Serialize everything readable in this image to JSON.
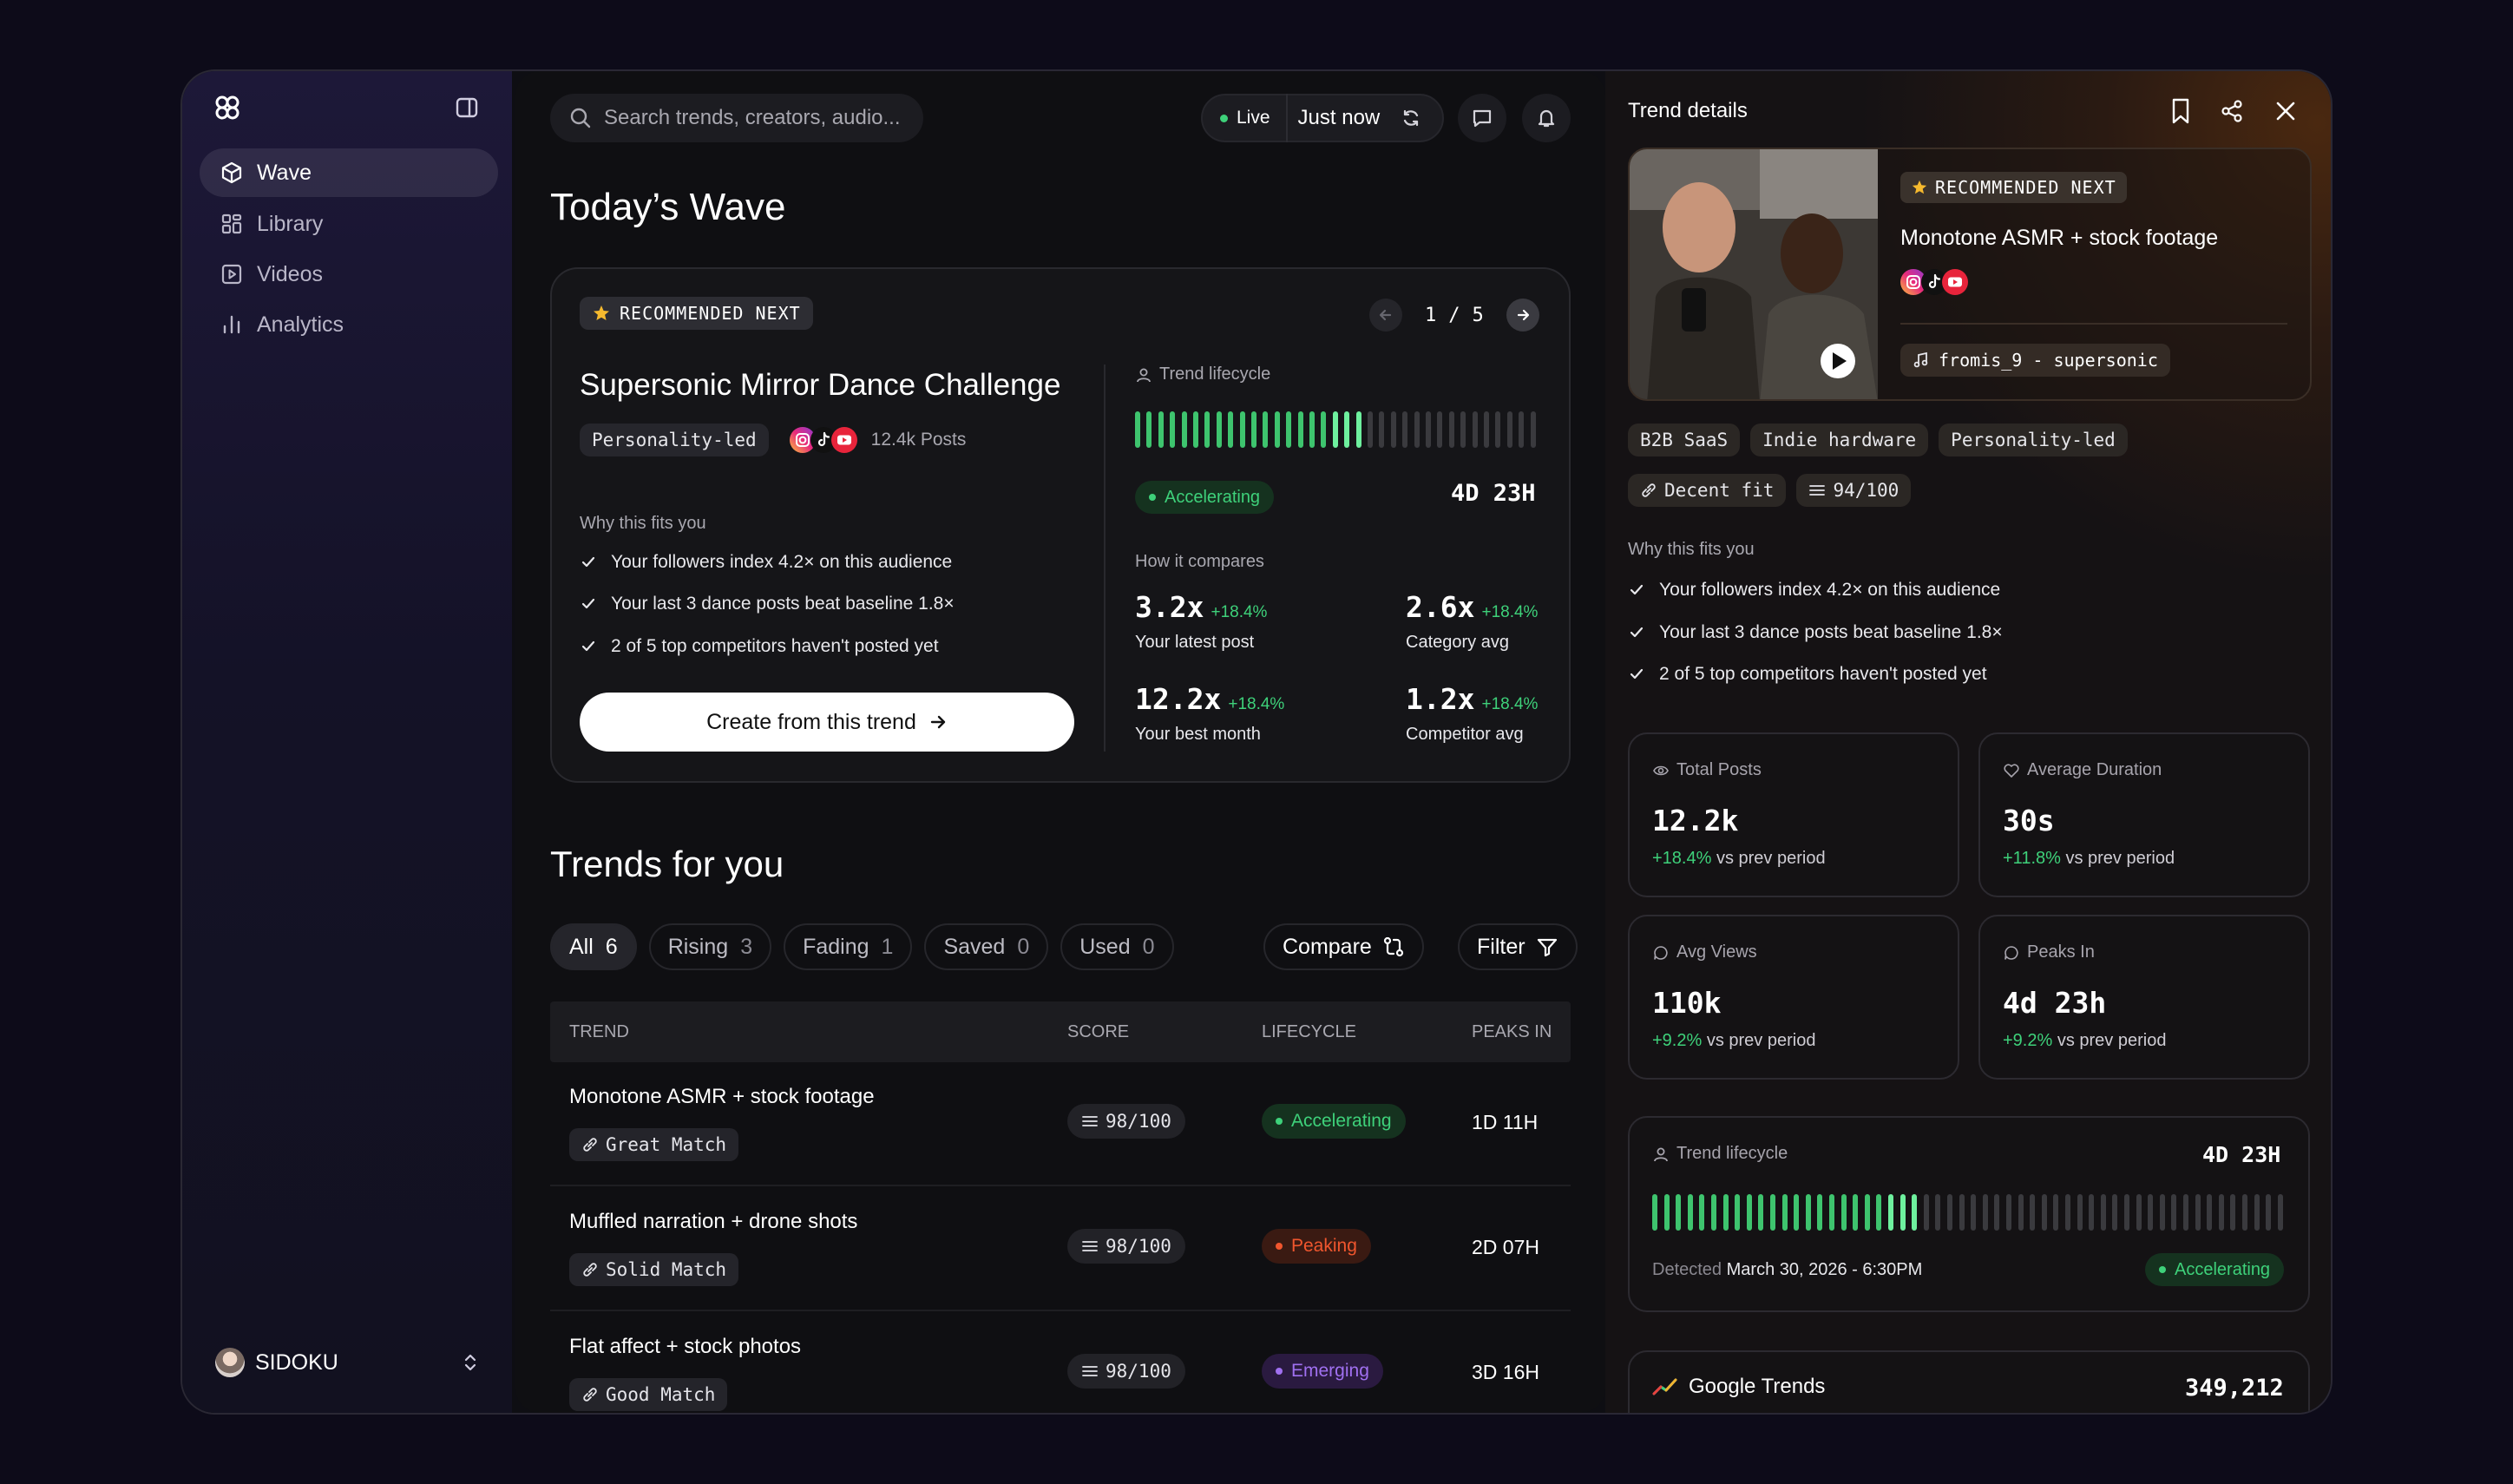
{
  "sidebar": {
    "nav": [
      {
        "label": "Wave",
        "icon": "cube-icon"
      },
      {
        "label": "Library",
        "icon": "grid-icon"
      },
      {
        "label": "Videos",
        "icon": "play-square-icon"
      },
      {
        "label": "Analytics",
        "icon": "bar-chart-icon"
      }
    ],
    "user": {
      "name": "SIDOKU"
    }
  },
  "topbar": {
    "search_placeholder": "Search trends, creators, audio...",
    "live_label": "Live",
    "updated_label": "Just now"
  },
  "wave": {
    "title": "Today’s Wave",
    "badge": "RECOMMENDED NEXT",
    "pager": {
      "current": "1",
      "sep": "/",
      "total": "5"
    },
    "trend_name": "Supersonic Mirror Dance Challenge",
    "tag": "Personality-led",
    "posts": "12.4k Posts",
    "why_title": "Why this fits you",
    "reasons": [
      "Your followers index 4.2× on this audience",
      "Your last 3 dance posts beat baseline 1.8×",
      "2 of 5 top competitors haven't posted yet"
    ],
    "cta": "Create from this trend",
    "lifecycle_label": "Trend lifecycle",
    "lifecycle_progress": 0.57,
    "status": "Accelerating",
    "time_left": "4D 23H",
    "compare_title": "How it compares",
    "compares": [
      {
        "value": "3.2x",
        "delta": "+18.4%",
        "label": "Your latest post"
      },
      {
        "value": "2.6x",
        "delta": "+18.4%",
        "label": "Category avg"
      },
      {
        "value": "12.2x",
        "delta": "+18.4%",
        "label": "Your best month"
      },
      {
        "value": "1.2x",
        "delta": "+18.4%",
        "label": "Competitor avg"
      }
    ]
  },
  "trends": {
    "title": "Trends for you",
    "tabs": [
      {
        "label": "All",
        "count": "6"
      },
      {
        "label": "Rising",
        "count": "3"
      },
      {
        "label": "Fading",
        "count": "1"
      },
      {
        "label": "Saved",
        "count": "0"
      },
      {
        "label": "Used",
        "count": "0"
      }
    ],
    "compare_label": "Compare",
    "filter_label": "Filter",
    "columns": {
      "trend": "TREND",
      "score": "SCORE",
      "lifecycle": "LIFECYCLE",
      "peaks": "PEAKS IN"
    },
    "rows": [
      {
        "name": "Monotone ASMR + stock footage",
        "match": "Great Match",
        "score": "98/100",
        "lifecycle": "Accelerating",
        "lifecycle_color": "#3ed17a",
        "peaks": "1D 11H"
      },
      {
        "name": "Muffled narration + drone shots",
        "match": "Solid Match",
        "score": "98/100",
        "lifecycle": "Peaking",
        "lifecycle_color": "#f0562e",
        "peaks": "2D 07H"
      },
      {
        "name": "Flat affect + stock photos",
        "match": "Good Match",
        "score": "98/100",
        "lifecycle": "Emerging",
        "lifecycle_color": "#a070f0",
        "peaks": "3D 16H"
      }
    ]
  },
  "details": {
    "title": "Trend details",
    "badge": "RECOMMENDED NEXT",
    "name": "Monotone ASMR + stock footage",
    "audio": "fromis_9 - supersonic",
    "tags": [
      "B2B SaaS",
      "Indie hardware",
      "Personality-led"
    ],
    "fit": "Decent fit",
    "score": "94/100",
    "why_title": "Why this fits you",
    "reasons": [
      "Your followers index 4.2× on this audience",
      "Your last 3 dance posts beat baseline 1.8×",
      "2 of 5 top competitors haven't posted yet"
    ],
    "stats": [
      {
        "label": "Total Posts",
        "value": "12.2k",
        "delta": "+18.4%",
        "suffix": "vs prev period",
        "icon": "eye-icon"
      },
      {
        "label": "Average Duration",
        "value": "30s",
        "delta": "+11.8%",
        "suffix": "vs prev period",
        "icon": "heart-icon"
      },
      {
        "label": "Avg Views",
        "value": "110k",
        "delta": "+9.2%",
        "suffix": "vs prev period",
        "icon": "comment-icon"
      },
      {
        "label": "Peaks In",
        "value": "4d 23h",
        "delta": "+9.2%",
        "suffix": "vs prev period",
        "icon": "comment-icon"
      }
    ],
    "lifecycle_label": "Trend lifecycle",
    "lifecycle_time": "4D 23H",
    "lifecycle_progress": 0.43,
    "detected_label": "Detected",
    "detected_date": "March 30, 2026 - 6:30PM",
    "status": "Accelerating",
    "google_label": "Google Trends",
    "google_value": "349,212"
  },
  "colors": {
    "accent_green": "#3ed17a",
    "peaking": "#f0562e",
    "emerging": "#a070f0"
  }
}
